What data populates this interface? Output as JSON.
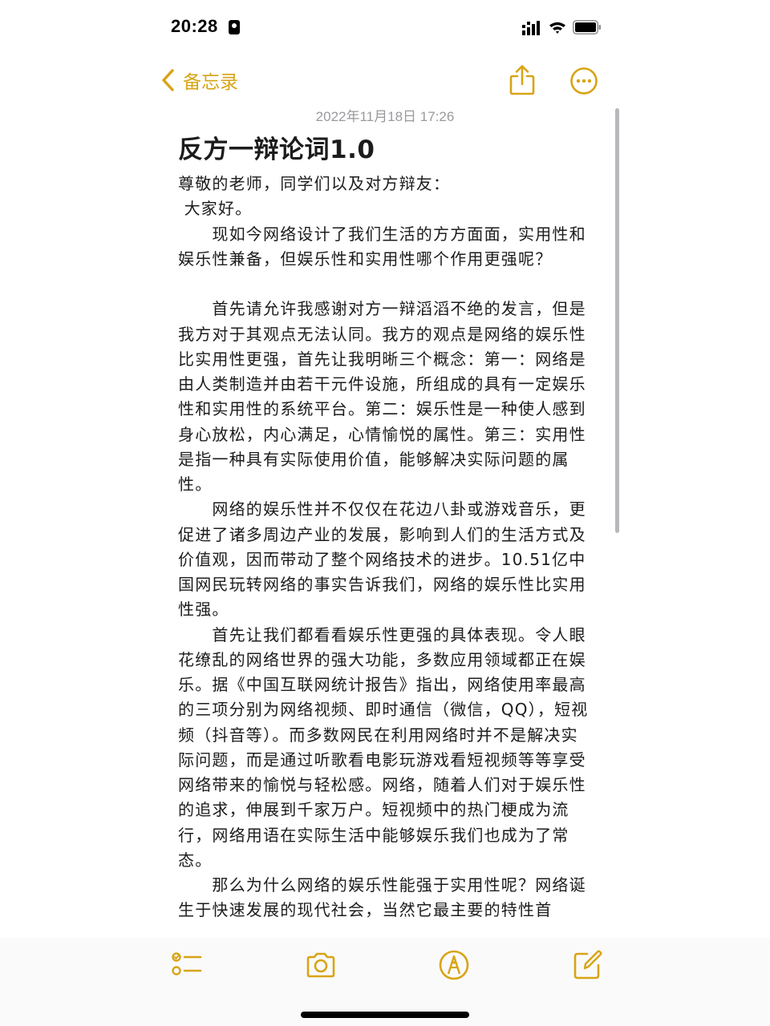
{
  "status_bar": {
    "time": "20:28"
  },
  "nav": {
    "back_label": "备忘录",
    "share_icon": "share-icon",
    "more_icon": "more-icon"
  },
  "note": {
    "date": "2022年11月18日 17:26",
    "title": "反方一辩论词1.0",
    "paragraphs": [
      "尊敬的老师，同学们以及对方辩友：",
      " 大家好。",
      "　　现如今网络设计了我们生活的方方面面，实用性和娱乐性兼备，但娱乐性和实用性哪个作用更强呢？",
      "",
      "　　首先请允许我感谢对方一辩滔滔不绝的发言，但是我方对于其观点无法认同。我方的观点是网络的娱乐性比实用性更强，首先让我明晰三个概念：第一：网络是由人类制造并由若干元件设施，所组成的具有一定娱乐性和实用性的系统平台。第二：娱乐性是一种使人感到身心放松，内心满足，心情愉悦的属性。第三：实用性是指一种具有实际使用价值，能够解决实际问题的属性。",
      "　　网络的娱乐性并不仅仅在花边八卦或游戏音乐，更促进了诸多周边产业的发展，影响到人们的生活方式及价值观，因而带动了整个网络技术的进步。10.51亿中国网民玩转网络的事实告诉我们，网络的娱乐性比实用性强。",
      "　　首先让我们都看看娱乐性更强的具体表现。令人眼花缭乱的网络世界的强大功能，多数应用领域都正在娱乐。据《中国互联网统计报告》指出，网络使用率最高的三项分别为网络视频、即时通信（微信，QQ），短视频（抖音等）。而多数网民在利用网络时并不是解决实际问题，而是通过听歌看电影玩游戏看短视频等等享受网络带来的愉悦与轻松感。网络，随着人们对于娱乐性的追求，伸展到千家万户。短视频中的热门梗成为流行，网络用语在实际生活中能够娱乐我们也成为了常态。",
      "　　那么为什么网络的娱乐性能强于实用性呢？网络诞生于快速发展的现代社会，当然它最主要的特性首"
    ]
  },
  "toolbar": {
    "checklist_icon": "checklist-icon",
    "camera_icon": "camera-icon",
    "markup_icon": "markup-icon",
    "compose_icon": "compose-icon"
  },
  "colors": {
    "accent": "#d8a414",
    "text": "#1c1c1e",
    "date_text": "#9a9a9e",
    "background": "#ffffff"
  }
}
